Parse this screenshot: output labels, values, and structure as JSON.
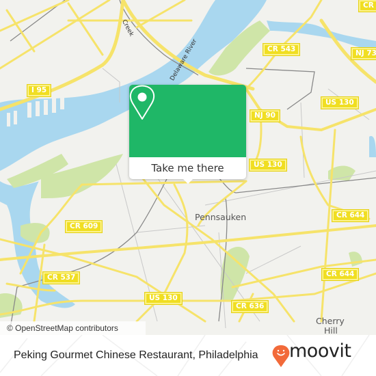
{
  "map": {
    "shields": [
      {
        "id": "i95",
        "label": "I 95"
      },
      {
        "id": "cr543",
        "label": "CR 543"
      },
      {
        "id": "nj73",
        "label": "NJ 73"
      },
      {
        "id": "cr543b",
        "label": "CR 5"
      },
      {
        "id": "nj90",
        "label": "NJ 90"
      },
      {
        "id": "us130a",
        "label": "US 130"
      },
      {
        "id": "us130b",
        "label": "US 130"
      },
      {
        "id": "cr609",
        "label": "CR 609"
      },
      {
        "id": "cr644a",
        "label": "CR 644"
      },
      {
        "id": "cr537",
        "label": "CR 537"
      },
      {
        "id": "cr644b",
        "label": "CR 644"
      },
      {
        "id": "us130c",
        "label": "US 130"
      },
      {
        "id": "cr636",
        "label": "CR 636"
      }
    ],
    "places": {
      "pennsauken": "Pennsauken",
      "cherry_hill_1": "Cherry",
      "cherry_hill_2": "Hill"
    },
    "water_labels": {
      "delaware_river": "Delaware River",
      "creek": "Creek"
    },
    "attribution": "© OpenStreetMap contributors",
    "colors": {
      "land": "#f2f2ee",
      "water": "#a9d7ef",
      "park": "#cfe5a8",
      "road": "#f6e36a",
      "shield": "#f0de22"
    }
  },
  "popup": {
    "icon": "location-pin-icon",
    "button_label": "Take me there",
    "color": "#1fb767"
  },
  "footer": {
    "title": "Peking Gourmet Chinese Restaurant, Philadelphia",
    "logo_text": "moovit",
    "logo_icon": "moovit-smile-pin-icon",
    "logo_color": "#f26a3a"
  }
}
